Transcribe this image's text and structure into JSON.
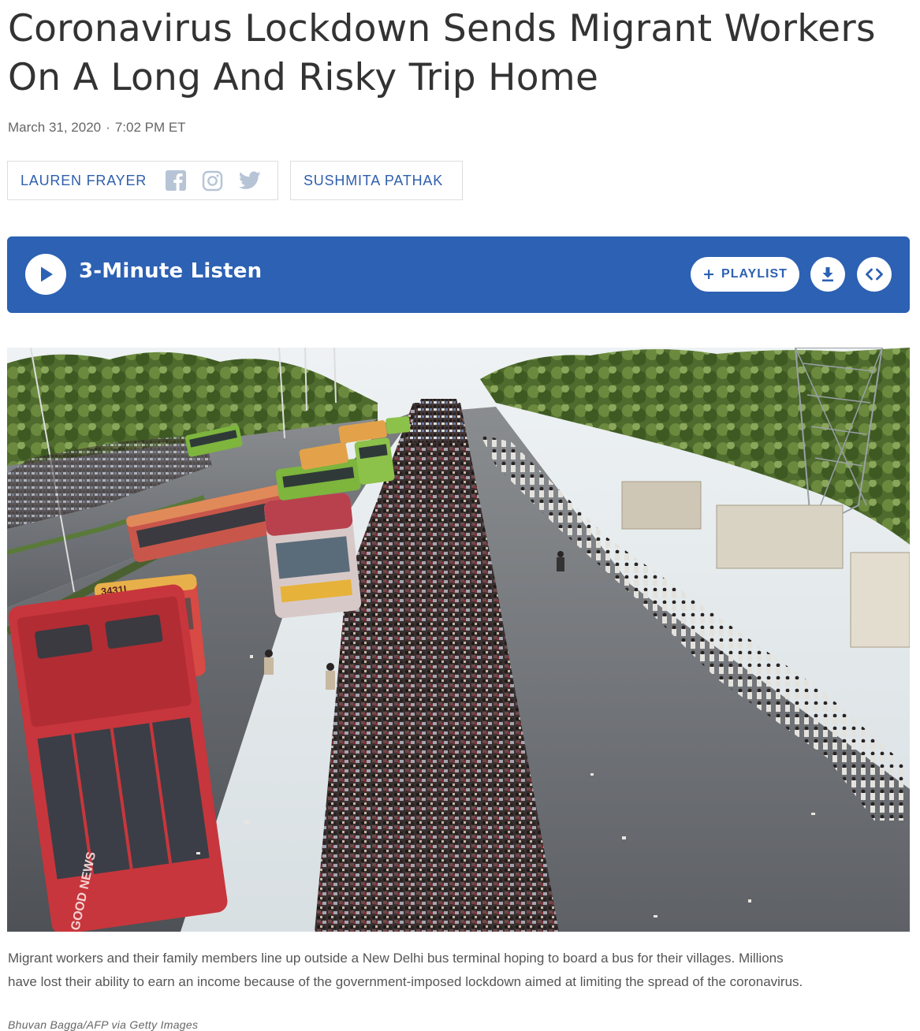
{
  "article": {
    "headline": "Coronavirus Lockdown Sends Migrant Workers On A Long And Risky Trip Home",
    "date": "March 31, 2020",
    "separator": "·",
    "time": "7:02 PM ET"
  },
  "bylines": [
    {
      "name": "LAUREN FRAYER",
      "social_icons": [
        "facebook-icon",
        "instagram-icon",
        "twitter-icon"
      ]
    },
    {
      "name": "SUSHMITA PATHAK"
    }
  ],
  "audio": {
    "listen_label": "3-Minute Listen",
    "playlist_plus": "+",
    "playlist_label": "PLAYLIST",
    "icons": [
      "play-icon",
      "download-icon",
      "embed-icon"
    ],
    "accent_color": "#2c61b3"
  },
  "image": {
    "bus_number": "3431L",
    "bus_side_text": "GOOD NEWS",
    "caption": "Migrant workers and their family members line up outside a New Delhi bus terminal hoping to board a bus for their villages. Millions have lost their ability to earn an income because of the government-imposed lockdown aimed at limiting the spread of the coronavirus.",
    "credit": "Bhuvan Bagga/AFP via Getty Images"
  }
}
